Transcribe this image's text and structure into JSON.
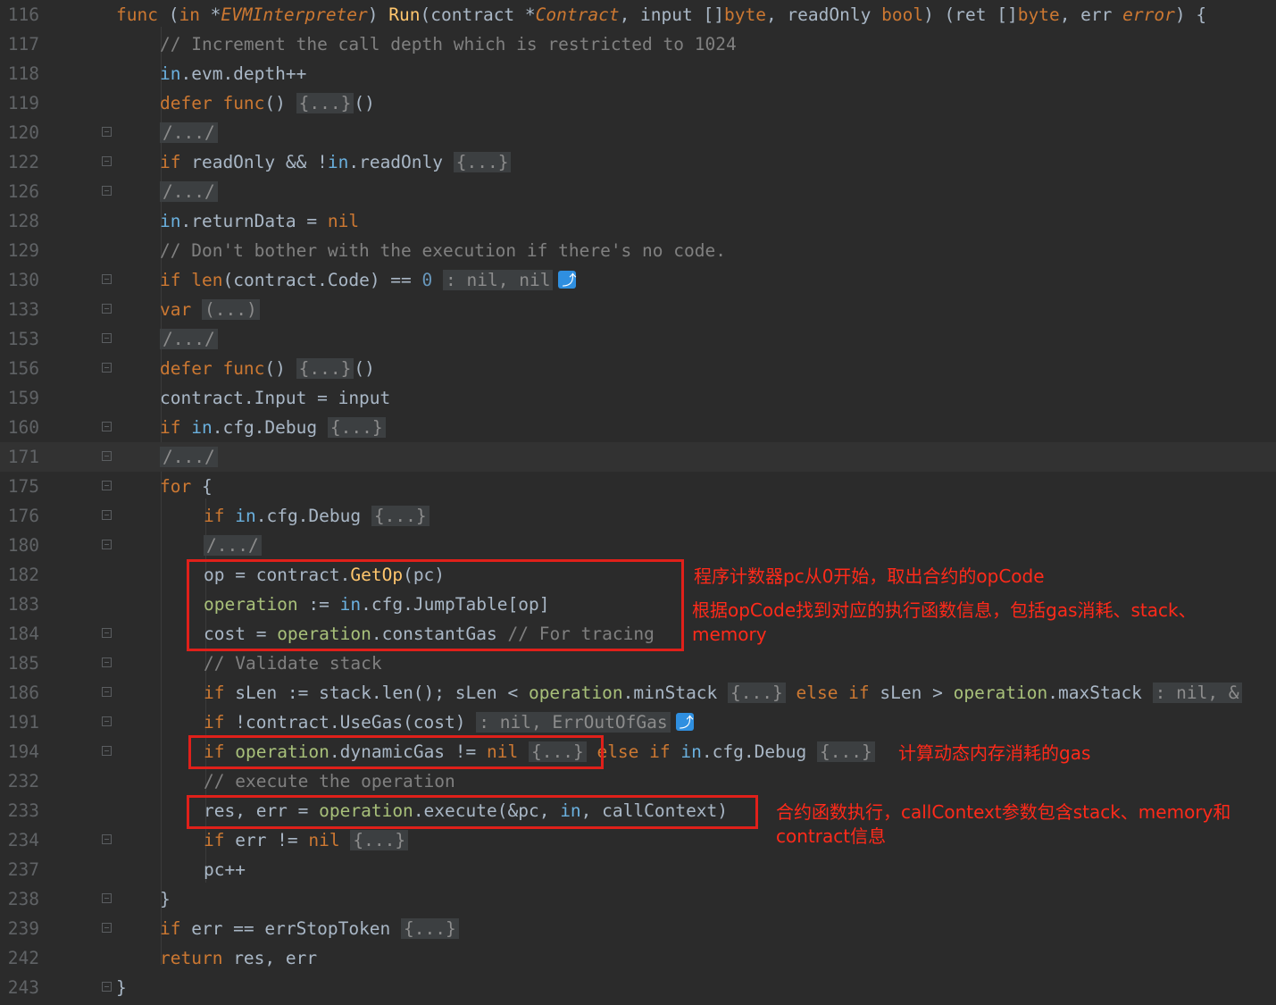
{
  "lines": [
    {
      "n": "116",
      "parts": [
        [
          "k",
          "func"
        ],
        [
          "p",
          " ("
        ],
        [
          "k",
          "in"
        ],
        [
          "p",
          " *"
        ],
        [
          "ty",
          "EVMInterpreter"
        ],
        [
          "p",
          ") "
        ],
        [
          "fn",
          "Run"
        ],
        [
          "p",
          "(contract *"
        ],
        [
          "ty",
          "Contract"
        ],
        [
          "p",
          ", input []"
        ],
        [
          "k",
          "byte"
        ],
        [
          "p",
          ", readOnly "
        ],
        [
          "k",
          "bool"
        ],
        [
          "p",
          ") (ret []"
        ],
        [
          "k",
          "byte"
        ],
        [
          "p",
          ", err "
        ],
        [
          "ty",
          "error"
        ],
        [
          "p",
          ") {"
        ]
      ]
    },
    {
      "n": "117",
      "parts": [
        [
          "cm",
          "// Increment the call depth which is restricted to 1024"
        ]
      ]
    },
    {
      "n": "118",
      "parts": [
        [
          "in",
          "in"
        ],
        [
          "p",
          ".evm.depth++"
        ]
      ]
    },
    {
      "n": "119",
      "parts": [
        [
          "k",
          "defer"
        ],
        [
          "p",
          " "
        ],
        [
          "k",
          "func"
        ],
        [
          "p",
          "() "
        ],
        [
          "fold",
          "{...}"
        ],
        [
          "p",
          "()"
        ]
      ]
    },
    {
      "n": "120",
      "parts": [
        [
          "fold",
          "/.../"
        ]
      ]
    },
    {
      "n": "122",
      "parts": [
        [
          "k",
          "if"
        ],
        [
          "p",
          " readOnly && !"
        ],
        [
          "in",
          "in"
        ],
        [
          "p",
          ".readOnly "
        ],
        [
          "fold",
          "{...}"
        ]
      ]
    },
    {
      "n": "126",
      "parts": [
        [
          "fold",
          "/.../"
        ]
      ]
    },
    {
      "n": "128",
      "parts": [
        [
          "in",
          "in"
        ],
        [
          "p",
          ".returnData = "
        ],
        [
          "k",
          "nil"
        ]
      ]
    },
    {
      "n": "129",
      "parts": [
        [
          "cm",
          "// Don't bother with the execution if there's no code."
        ]
      ]
    },
    {
      "n": "130",
      "parts": [
        [
          "k",
          "if"
        ],
        [
          "p",
          " "
        ],
        [
          "k",
          "len"
        ],
        [
          "p",
          "(contract.Code) == "
        ],
        [
          "num",
          "0"
        ],
        [
          "p",
          " "
        ],
        [
          "fold",
          ": nil, nil"
        ]
      ],
      "ret": true
    },
    {
      "n": "133",
      "parts": [
        [
          "k",
          "var"
        ],
        [
          "p",
          " "
        ],
        [
          "fold",
          "(...)"
        ]
      ]
    },
    {
      "n": "153",
      "parts": [
        [
          "fold",
          "/.../"
        ]
      ]
    },
    {
      "n": "156",
      "parts": [
        [
          "k",
          "defer"
        ],
        [
          "p",
          " "
        ],
        [
          "k",
          "func"
        ],
        [
          "p",
          "() "
        ],
        [
          "fold",
          "{...}"
        ],
        [
          "p",
          "()"
        ]
      ]
    },
    {
      "n": "159",
      "parts": [
        [
          "p",
          "contract.Input = input"
        ]
      ]
    },
    {
      "n": "160",
      "parts": [
        [
          "k",
          "if"
        ],
        [
          "p",
          " "
        ],
        [
          "in",
          "in"
        ],
        [
          "p",
          ".cfg.Debug "
        ],
        [
          "fold",
          "{...}"
        ]
      ]
    },
    {
      "n": "171",
      "parts": [
        [
          "fold",
          "/.../"
        ]
      ],
      "current": true
    },
    {
      "n": "175",
      "parts": [
        [
          "k",
          "for"
        ],
        [
          "p",
          " {"
        ]
      ]
    },
    {
      "n": "176",
      "parts": [
        [
          "k",
          "if"
        ],
        [
          "p",
          " "
        ],
        [
          "in",
          "in"
        ],
        [
          "p",
          ".cfg.Debug "
        ],
        [
          "fold",
          "{...}"
        ]
      ]
    },
    {
      "n": "180",
      "parts": [
        [
          "fold",
          "/.../"
        ]
      ]
    },
    {
      "n": "182",
      "parts": [
        [
          "p",
          "op = contract."
        ],
        [
          "fn",
          "GetOp"
        ],
        [
          "p",
          "(pc)"
        ]
      ]
    },
    {
      "n": "183",
      "parts": [
        [
          "mth",
          "operation"
        ],
        [
          "p",
          " := "
        ],
        [
          "in",
          "in"
        ],
        [
          "p",
          ".cfg.JumpTable[op]"
        ]
      ]
    },
    {
      "n": "184",
      "parts": [
        [
          "p",
          "cost = "
        ],
        [
          "mth",
          "operation"
        ],
        [
          "p",
          ".constantGas "
        ],
        [
          "cm",
          "// For tracing"
        ]
      ]
    },
    {
      "n": "185",
      "parts": [
        [
          "cm",
          "// Validate stack"
        ]
      ]
    },
    {
      "n": "186",
      "parts": [
        [
          "k",
          "if"
        ],
        [
          "p",
          " sLen := stack.len(); sLen < "
        ],
        [
          "mth",
          "operation"
        ],
        [
          "p",
          ".minStack "
        ],
        [
          "fold",
          "{...}"
        ],
        [
          "p",
          " "
        ],
        [
          "k",
          "else if"
        ],
        [
          "p",
          " sLen > "
        ],
        [
          "mth",
          "operation"
        ],
        [
          "p",
          ".maxStack "
        ],
        [
          "fold",
          ": nil, &"
        ]
      ]
    },
    {
      "n": "191",
      "parts": [
        [
          "k",
          "if"
        ],
        [
          "p",
          " !contract.UseGas(cost) "
        ],
        [
          "fold",
          ": nil, ErrOutOfGas"
        ]
      ],
      "ret": true
    },
    {
      "n": "194",
      "parts": [
        [
          "k",
          "if"
        ],
        [
          "p",
          " "
        ],
        [
          "mth",
          "operation"
        ],
        [
          "p",
          ".dynamicGas != "
        ],
        [
          "k",
          "nil"
        ],
        [
          "p",
          " "
        ],
        [
          "fold",
          "{...}"
        ],
        [
          "p",
          " "
        ],
        [
          "k",
          "else if"
        ],
        [
          "p",
          " "
        ],
        [
          "in",
          "in"
        ],
        [
          "p",
          ".cfg.Debug "
        ],
        [
          "fold",
          "{...}"
        ]
      ]
    },
    {
      "n": "232",
      "parts": [
        [
          "cm",
          "// execute the operation"
        ]
      ]
    },
    {
      "n": "233",
      "parts": [
        [
          "p",
          "res, err = "
        ],
        [
          "mth",
          "operation"
        ],
        [
          "p",
          ".execute(&pc, "
        ],
        [
          "in",
          "in"
        ],
        [
          "p",
          ", callContext)"
        ]
      ]
    },
    {
      "n": "234",
      "parts": [
        [
          "k",
          "if"
        ],
        [
          "p",
          " err != "
        ],
        [
          "k",
          "nil"
        ],
        [
          "p",
          " "
        ],
        [
          "fold",
          "{...}"
        ]
      ]
    },
    {
      "n": "237",
      "parts": [
        [
          "p",
          "pc++"
        ]
      ]
    },
    {
      "n": "238",
      "parts": [
        [
          "p",
          "}"
        ]
      ]
    },
    {
      "n": "239",
      "parts": [
        [
          "k",
          "if"
        ],
        [
          "p",
          " err == errStopToken "
        ],
        [
          "fold",
          "{...}"
        ]
      ]
    },
    {
      "n": "242",
      "parts": [
        [
          "k",
          "return"
        ],
        [
          "p",
          " res, err"
        ]
      ]
    },
    {
      "n": "243",
      "parts": [
        [
          "p",
          "}"
        ]
      ]
    }
  ],
  "annotations": {
    "note1": "程序计数器pc从0开始，取出合约的opCode",
    "note2": "根据opCode找到对应的执行函数信息，包括gas消耗、stack、\nmemory",
    "note3": "计算动态内存消耗的gas",
    "note4": "合约函数执行，callContext参数包含stack、memory和\ncontract信息"
  },
  "colors": {
    "background": "#2b2b2b",
    "keyword": "#cc7832",
    "function": "#ffc66d",
    "comment": "#808080",
    "annotation": "#ff2a1a",
    "highlight_box": "#e0201a"
  }
}
